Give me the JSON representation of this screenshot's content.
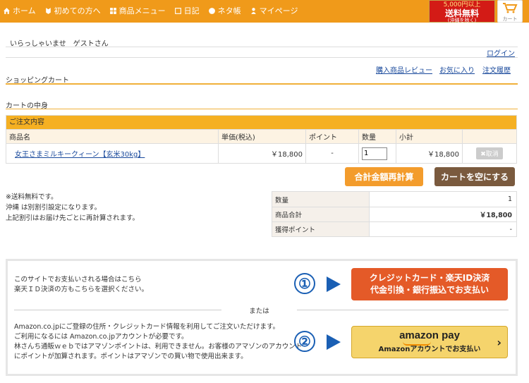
{
  "nav": {
    "items": [
      {
        "label": "ホーム",
        "icon": "home-icon"
      },
      {
        "label": "初めての方へ",
        "icon": "beginner-mark-icon"
      },
      {
        "label": "商品メニュー",
        "icon": "menu-grid-icon"
      },
      {
        "label": "日記",
        "icon": "book-icon"
      },
      {
        "label": "ネタ帳",
        "icon": "note-circle-icon"
      },
      {
        "label": "マイページ",
        "icon": "person-icon"
      }
    ],
    "ship_badge": {
      "line1": "5,000円以上",
      "line2": "送料無料",
      "line3": "(沖縄を除く)"
    },
    "cart_label": "カート"
  },
  "header": {
    "welcome": "いらっしゃいませ　ゲストさん",
    "login": "ログイン",
    "links": [
      "購入商品レビュー",
      "お気に入り",
      "注文履歴"
    ]
  },
  "page_title": "ショッピングカート",
  "cart_contents_title": "カートの中身",
  "order_table": {
    "caption": "ご注文内容",
    "columns": [
      "商品名",
      "単価(税込)",
      "ポイント",
      "数量",
      "小計",
      ""
    ],
    "rows": [
      {
        "name": "女王さまミルキークィーン【玄米30kg】",
        "price": "￥18,800",
        "points": "-",
        "qty": "1",
        "subtotal": "￥18,800",
        "delete": "✖取消"
      }
    ]
  },
  "buttons": {
    "recalc": "合計金額再計算",
    "empty": "カートを空にする"
  },
  "notes": [
    "※送料無料です。",
    "沖縄 は別割引設定になります。",
    "上記割引はお届け先ごとに再計算されます。"
  ],
  "summary": [
    {
      "label": "数量",
      "value": "1"
    },
    {
      "label": "商品合計",
      "value": "￥18,800"
    },
    {
      "label": "獲得ポイント",
      "value": "-"
    }
  ],
  "payment": {
    "intro": [
      "このサイトでお支払いされる場合はこちら",
      "楽天ＩＤ決済の方もこちらを選択ください。"
    ],
    "num1": "①",
    "card_button": [
      "クレジットカード・楽天ID決済",
      "代金引換・銀行振込でお支払い"
    ],
    "or": "または",
    "amazon_text": [
      "Amazon.co.jpにご登録の住所・クレジットカード情報を利用してご注文いただけます。",
      "ご利用になるには Amazon.co.jpアカウントが必要です。",
      "林さんち通販ｗｅｂではアマゾンポイントは、利用できません。お客様のアマゾンのアカウント",
      "にポイントが加算されます。ポイントはアマゾンでの買い物で使用出来ます。"
    ],
    "num2": "②",
    "amazon_logo": "amazon pay",
    "amazon_sub": "Amazonアカウントでお支払い",
    "amazon_chevron": "›"
  },
  "colors": {
    "nav_bg": "#f09a1a",
    "accent": "#f5b022",
    "card_button": "#e45a28",
    "empty_button": "#7a5a3e",
    "amazon": "#f5d46c"
  }
}
